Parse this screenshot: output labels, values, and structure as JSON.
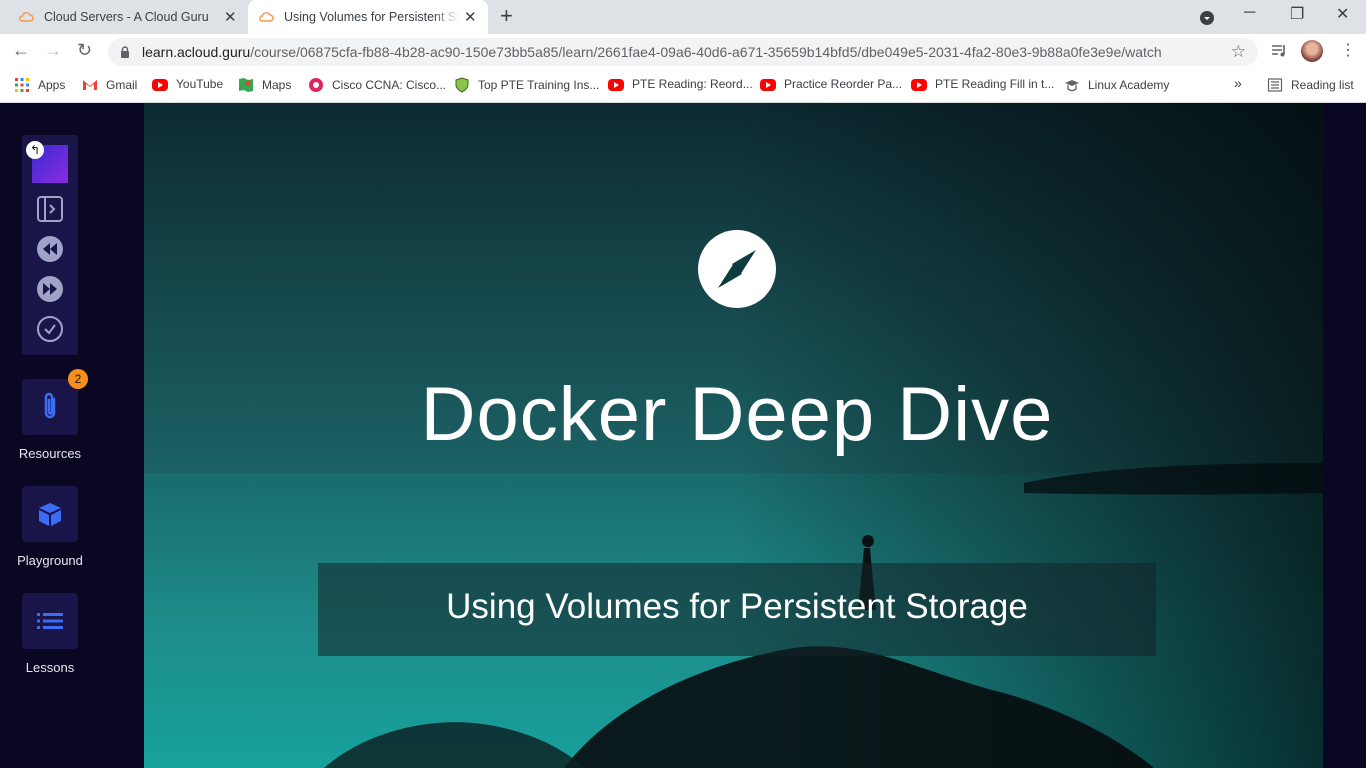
{
  "browser": {
    "tabs": [
      {
        "title": "Cloud Servers - A Cloud Guru",
        "active": false
      },
      {
        "title": "Using Volumes for Persistent Storage",
        "active": true
      }
    ],
    "url_host": "learn.acloud.guru",
    "url_path": "/course/06875cfa-fb88-4b28-ac90-150e73bb5a85/learn/2661fae4-09a6-40d6-a671-35659b14bfd5/dbe049e5-2031-4fa2-80e3-9b88a0fe3e9e/watch",
    "bookmarks": [
      {
        "label": "Apps",
        "icon": "apps-grid-icon"
      },
      {
        "label": "Gmail",
        "icon": "gmail-icon"
      },
      {
        "label": "YouTube",
        "icon": "youtube-icon"
      },
      {
        "label": "Maps",
        "icon": "maps-icon"
      },
      {
        "label": "Cisco CCNA: Cisco...",
        "icon": "cisco-icon"
      },
      {
        "label": "Top PTE Training Ins...",
        "icon": "pte-shield-icon"
      },
      {
        "label": "PTE Reading: Reord...",
        "icon": "youtube-icon"
      },
      {
        "label": "Practice Reorder Pa...",
        "icon": "youtube-icon"
      },
      {
        "label": "PTE Reading Fill in t...",
        "icon": "youtube-icon"
      },
      {
        "label": "Linux Academy",
        "icon": "graduation-cap-icon"
      }
    ],
    "more_bookmarks": "»",
    "reading_list": "Reading list"
  },
  "sidebar": {
    "resources": {
      "label": "Resources",
      "badge": "2"
    },
    "playground": {
      "label": "Playground"
    },
    "lessons": {
      "label": "Lessons"
    }
  },
  "video": {
    "course_title": "Docker Deep Dive",
    "lesson_title": "Using Volumes for Persistent Storage"
  },
  "colors": {
    "nav_bg": "#0a0722",
    "button_bg": "#1a1549",
    "badge": "#f78f1e",
    "accent_blue": "#3b6cf6"
  }
}
